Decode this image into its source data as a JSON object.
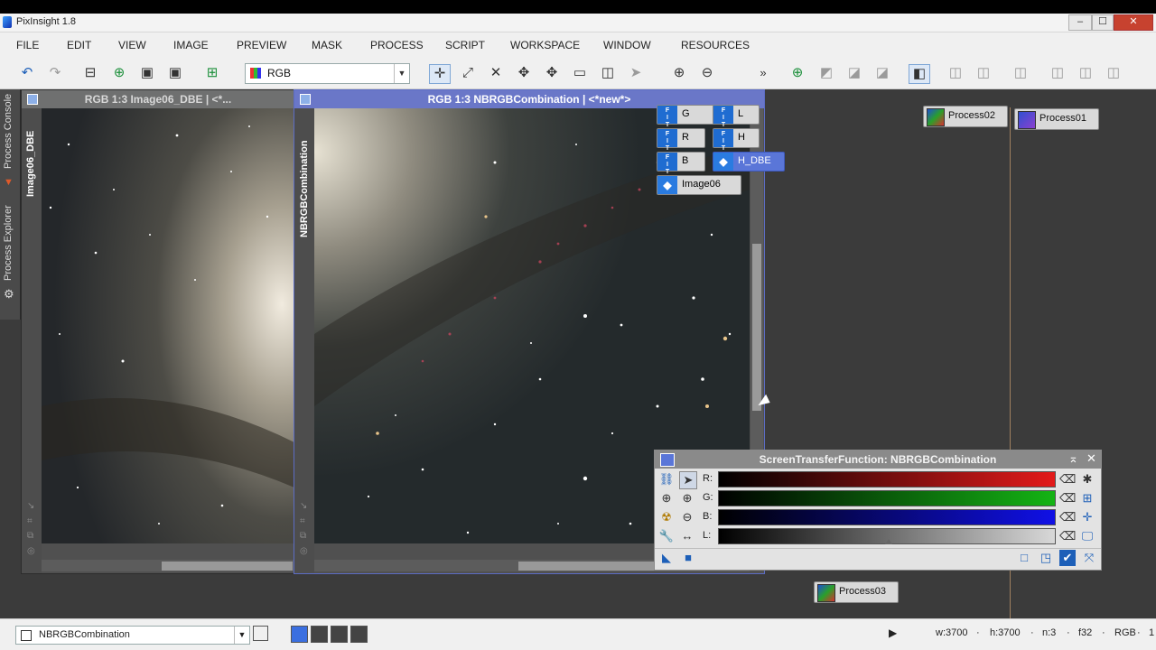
{
  "window": {
    "title": "PixInsight 1.8",
    "controls": [
      "–",
      "☐",
      "✕"
    ]
  },
  "menu": [
    "FILE",
    "EDIT",
    "VIEW",
    "IMAGE",
    "PREVIEW",
    "MASK",
    "PROCESS",
    "SCRIPT",
    "WORKSPACE",
    "WINDOW",
    "RESOURCES"
  ],
  "toolbar": {
    "color_space": "RGB",
    "overflow": "»"
  },
  "side_dock": {
    "tabs": [
      "Process Console",
      "Process Explorer"
    ]
  },
  "image_windows": [
    {
      "title": "RGB 1:3 Image06_DBE | <*...",
      "view_id": "Image06_DBE"
    },
    {
      "title": "RGB 1:3 NBRGBCombination | <*new*>",
      "view_id": "NBRGBCombination"
    }
  ],
  "file_icons": [
    {
      "label": "G",
      "type": "fits"
    },
    {
      "label": "L",
      "type": "fits"
    },
    {
      "label": "R",
      "type": "fits"
    },
    {
      "label": "H",
      "type": "fits"
    },
    {
      "label": "B",
      "type": "fits"
    },
    {
      "label": "H_DBE",
      "type": "view",
      "selected": true
    },
    {
      "label": "Image06",
      "type": "view"
    }
  ],
  "process_icons": [
    "Process02",
    "Process01",
    "Process03"
  ],
  "stf": {
    "title": "ScreenTransferFunction: NBRGBCombination",
    "channels": [
      {
        "label": "R:",
        "color": "#e31a1a"
      },
      {
        "label": "G:",
        "color": "#14b414"
      },
      {
        "label": "B:",
        "color": "#1010e6"
      },
      {
        "label": "L:",
        "color": "#d8d8d8"
      }
    ]
  },
  "status": {
    "view": "NBRGBCombination",
    "w": "w:3700",
    "h": "h:3700",
    "n": "n:3",
    "bits": "f32",
    "space": "RGB",
    "sep": "·",
    "extra": "1"
  }
}
